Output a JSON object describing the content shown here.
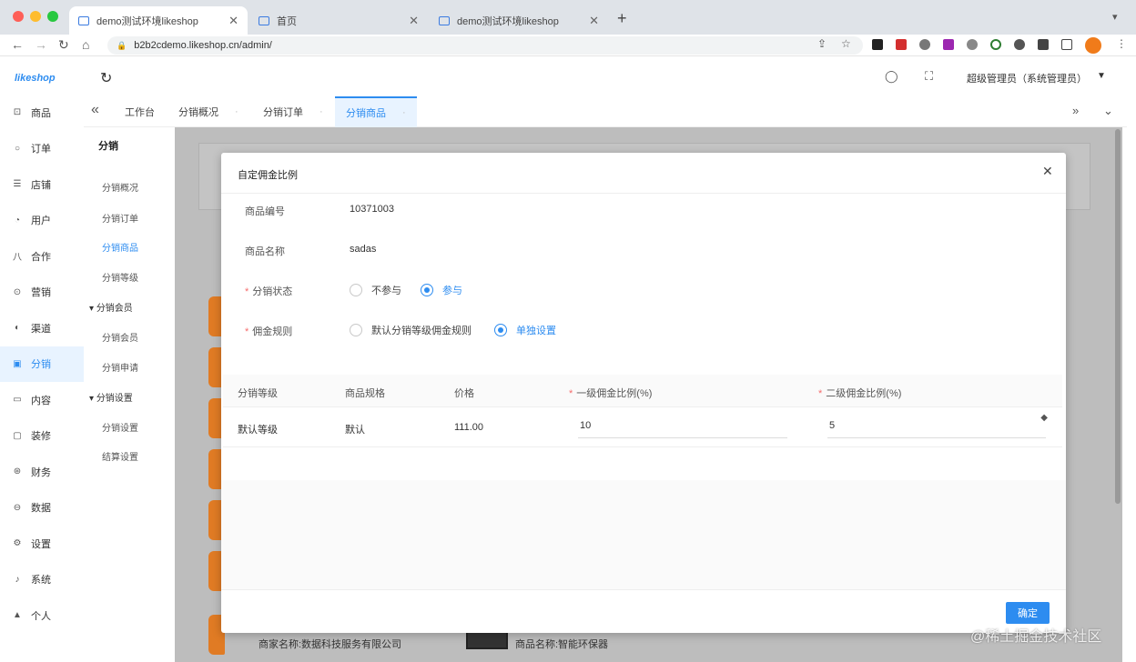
{
  "browser": {
    "tabs": [
      {
        "label": "demo测试环境likeshop"
      },
      {
        "label": "首页"
      },
      {
        "label": "demo测试环境likeshop"
      }
    ],
    "url": "b2b2cdemo.likeshop.cn/admin/"
  },
  "app": {
    "logo": "likeshop",
    "user": "超级管理员（系统管理员）"
  },
  "sidebar": {
    "items": [
      {
        "label": "商品",
        "icon": "bag-icon"
      },
      {
        "label": "订单",
        "icon": "order-icon"
      },
      {
        "label": "店铺",
        "icon": "store-icon"
      },
      {
        "label": "用户",
        "icon": "user-icon"
      },
      {
        "label": "合作",
        "icon": "partner-icon"
      },
      {
        "label": "营销",
        "icon": "marketing-icon"
      },
      {
        "label": "渠道",
        "icon": "channel-icon"
      },
      {
        "label": "分销",
        "icon": "distribution-icon"
      },
      {
        "label": "内容",
        "icon": "content-icon"
      },
      {
        "label": "装修",
        "icon": "decorate-icon"
      },
      {
        "label": "财务",
        "icon": "finance-icon"
      },
      {
        "label": "数据",
        "icon": "data-icon"
      },
      {
        "label": "设置",
        "icon": "settings-icon"
      },
      {
        "label": "系统",
        "icon": "system-icon"
      },
      {
        "label": "个人",
        "icon": "person-icon"
      }
    ],
    "active_index": 7
  },
  "submenu": {
    "title": "分销",
    "items": [
      "分销概况",
      "分销订单",
      "分销商品",
      "分销等级"
    ],
    "group1": "分销会员",
    "group1_items": [
      "分销会员",
      "分销申请"
    ],
    "group2": "分销设置",
    "group2_items": [
      "分销设置",
      "结算设置"
    ],
    "active": "分销商品"
  },
  "page_tabs": [
    "工作台",
    "分销概况",
    "分销订单",
    "分销商品"
  ],
  "page_tabs_active": 3,
  "background": {
    "shop_name": "商家名称:数据科技服务有限公司",
    "goods_name": "商品名称:智能环保器"
  },
  "modal": {
    "title": "自定佣金比例",
    "fields": {
      "goods_code_label": "商品编号",
      "goods_code": "10371003",
      "goods_name_label": "商品名称",
      "goods_name": "sadas",
      "participate_label": "分销状态",
      "participate_options": [
        "不参与",
        "参与"
      ],
      "participate_selected": 1,
      "rule_label": "佣金规则",
      "rule_options": [
        "默认分销等级佣金规则",
        "单独设置"
      ],
      "rule_selected": 1
    },
    "table": {
      "headers": [
        "分销等级",
        "商品规格",
        "价格",
        "一级佣金比例(%)",
        "二级佣金比例(%)"
      ],
      "rows": [
        {
          "level": "默认等级",
          "spec": "默认",
          "price": "111.00",
          "first_ratio": "10",
          "second_ratio": "5"
        }
      ]
    },
    "confirm": "确定"
  },
  "watermark": "@稀土掘金技术社区",
  "colors": {
    "accent": "#2d8cf0",
    "overlay": "#bdbdbd"
  }
}
